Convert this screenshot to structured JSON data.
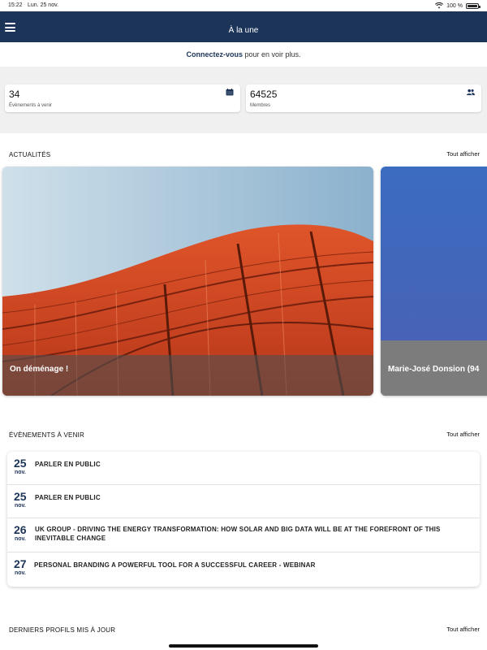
{
  "status_bar": {
    "time": "15:22",
    "date": "Lun. 25 nov.",
    "battery": "100 %"
  },
  "navbar": {
    "title": "À la une",
    "background": "#1c3458"
  },
  "connect_banner": {
    "link_text": "Connectez-vous",
    "text": " pour en voir plus."
  },
  "stats": [
    {
      "value": "34",
      "label": "Évènements à venir",
      "icon": "calendar-icon"
    },
    {
      "value": "64525",
      "label": "Membres",
      "icon": "people-icon"
    }
  ],
  "news": {
    "title": "ACTUALITÉS",
    "see_all": "Tout afficher",
    "cards": [
      {
        "title": "On déménage !"
      },
      {
        "title": "Marie-José Donsion (94"
      }
    ]
  },
  "events": {
    "title": "ÉVÈNEMENTS À VENIR",
    "see_all": "Tout afficher",
    "items": [
      {
        "day": "25",
        "month": "nov.",
        "title": "PARLER EN PUBLIC"
      },
      {
        "day": "25",
        "month": "nov.",
        "title": "PARLER EN PUBLIC"
      },
      {
        "day": "26",
        "month": "nov.",
        "title": "UK GROUP - DRIVING THE ENERGY TRANSFORMATION: HOW SOLAR AND BIG DATA WILL BE AT THE FOREFRONT OF THIS INEVITABLE CHANGE"
      },
      {
        "day": "27",
        "month": "nov.",
        "title": "PERSONAL BRANDING A POWERFUL TOOL FOR A SUCCESSFUL CAREER - WEBINAR"
      }
    ]
  },
  "profiles": {
    "title": "DERNIERS PROFILS MIS À JOUR",
    "see_all": "Tout afficher"
  }
}
